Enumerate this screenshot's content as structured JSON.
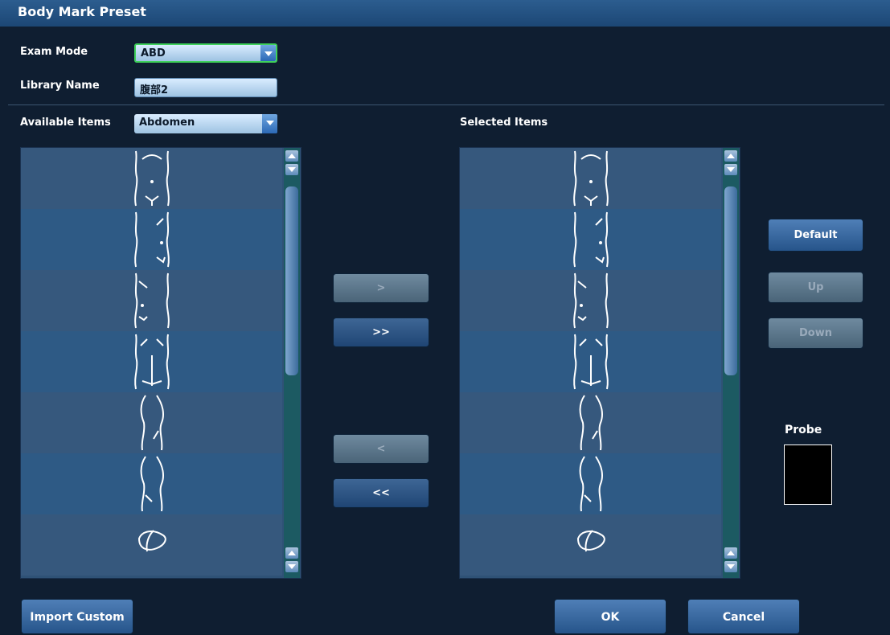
{
  "window": {
    "title": "Body Mark Preset"
  },
  "exam_mode": {
    "label": "Exam Mode",
    "value": "ABD"
  },
  "library_name": {
    "label": "Library Name",
    "value": "腹部2"
  },
  "available_items": {
    "label": "Available Items",
    "category": "Abdomen"
  },
  "selected_items": {
    "label": "Selected Items"
  },
  "body_marks": [
    "torso-front-1",
    "torso-front-2",
    "torso-front-3",
    "torso-front-4",
    "torso-side-1",
    "torso-side-2",
    "organ"
  ],
  "transfer_buttons": {
    "add": ">",
    "add_all": ">>",
    "remove": "<",
    "remove_all": "<<"
  },
  "side_buttons": {
    "default": "Default",
    "up": "Up",
    "down": "Down"
  },
  "probe": {
    "label": "Probe"
  },
  "footer": {
    "import_custom": "Import Custom",
    "ok": "OK",
    "cancel": "Cancel"
  },
  "colors": {
    "background": "#0e1c2e",
    "list_row_a": "#36587d",
    "list_row_b": "#2e5a85",
    "accent": "#3fd15b"
  }
}
